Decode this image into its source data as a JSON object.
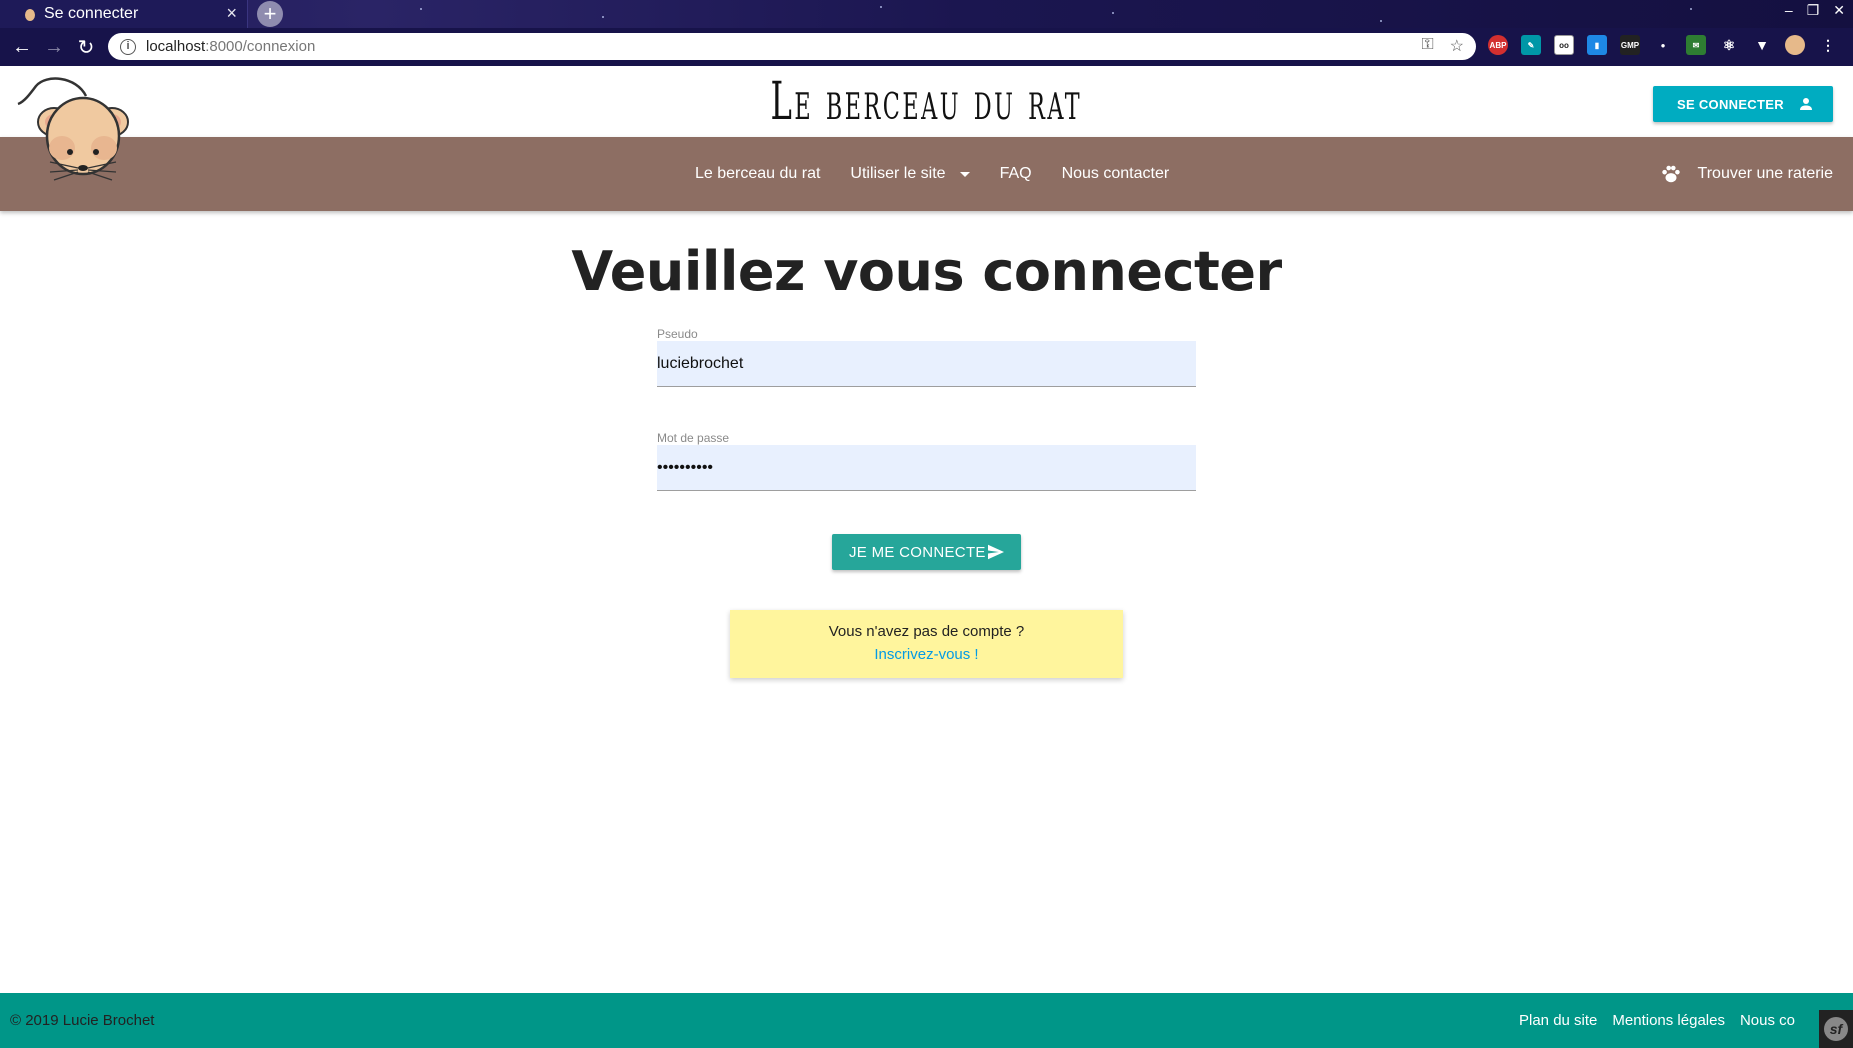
{
  "browser": {
    "tab_title": "Se connecter",
    "url_host": "localhost",
    "url_rest": ":8000/connexion",
    "extensions": [
      "ABP",
      "GMP"
    ]
  },
  "header": {
    "site_title": "Le berceau du rat",
    "login_button": "SE CONNECTER"
  },
  "nav": {
    "items": [
      "Le berceau du rat",
      "Utiliser le site",
      "FAQ",
      "Nous contacter"
    ],
    "right_label": "Trouver une raterie"
  },
  "main": {
    "heading": "Veuillez vous connecter",
    "username_label": "Pseudo",
    "username_value": "luciebrochet",
    "password_label": "Mot de passe",
    "password_value": "••••••••••",
    "submit_label": "JE ME CONNECTE",
    "signup_question": "Vous n'avez pas de compte ?",
    "signup_link": "Inscrivez-vous !"
  },
  "footer": {
    "copyright": "© 2019 Lucie Brochet",
    "links": [
      "Plan du site",
      "Mentions légales",
      "Nous contacter"
    ]
  },
  "colors": {
    "navbar": "#8d6e63",
    "login_button": "#00acc1",
    "submit_button": "#26a69a",
    "signup_card": "#fff59d",
    "footer": "#009688",
    "signup_link": "#039be5"
  }
}
